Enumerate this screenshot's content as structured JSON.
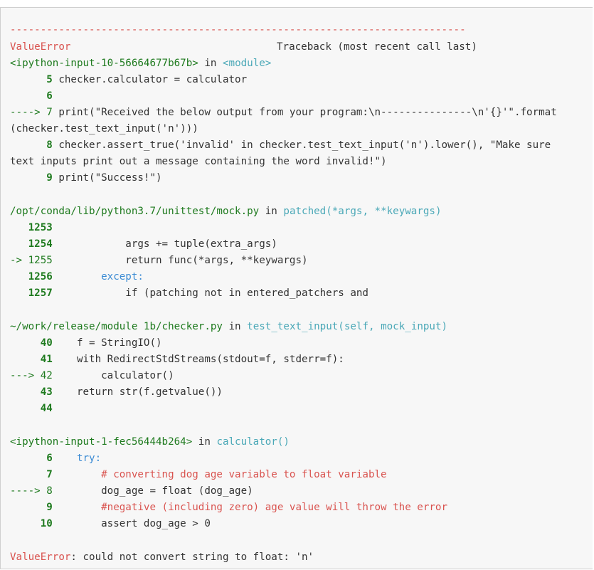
{
  "traceback": {
    "separator": "---------------------------------------------------------------------------",
    "error_type": "ValueError",
    "header_right": "Traceback (most recent call last)",
    "frame1": {
      "file": "<ipython-input-10-56664677b67b>",
      "in": "in",
      "func": "<module>",
      "l5_num": "5",
      "l5_code": "checker.calculator = calculator",
      "l6_num": "6",
      "l7_arrow": "----> 7",
      "l7_code": "print(\"Received the below output from your program:\\n---------------\\n'{}'\".format",
      "l7_cont": "(checker.test_text_input('n')))",
      "l8_num": "8",
      "l8_code": "checker.assert_true('invalid' in checker.test_text_input('n').lower(), \"Make sure",
      "l8_cont": "text inputs print out a message containing the word invalid!\")",
      "l9_num": "9",
      "l9_code": "print(\"Success!\")"
    },
    "frame2": {
      "file": "/opt/conda/lib/python3.7/unittest/mock.py",
      "in": "in",
      "func": "patched(*args, **keywargs)",
      "l1253": "1253",
      "l1254": "1254",
      "l1254_code": "            args += tuple(extra_args)",
      "l1255_arrow": "-> 1255",
      "l1255_code": "            return func(*args, **keywargs)",
      "l1256": "1256",
      "l1256_code": "        except:",
      "l1257": "1257",
      "l1257_code": "            if (patching not in entered_patchers and"
    },
    "frame3": {
      "file": "~/work/release/module 1b/checker.py",
      "in": "in",
      "func": "test_text_input(self, mock_input)",
      "l40": "40",
      "l40_code": "    f = StringIO()",
      "l41": "41",
      "l41_code": "    with RedirectStdStreams(stdout=f, stderr=f):",
      "l42_arrow": "---> 42",
      "l42_code": "        calculator()",
      "l43": "43",
      "l43_code": "    return str(f.getvalue())",
      "l44": "44"
    },
    "frame4": {
      "file": "<ipython-input-1-fec56444b264>",
      "in": "in",
      "func": "calculator()",
      "l6": "6",
      "l6_code": "    try:",
      "l7": "7",
      "l7_code": "        # converting dog age variable to float variable",
      "l8_arrow": "----> 8",
      "l8_code": "        dog_age = float (dog_age)",
      "l9": "9",
      "l9_code": "        #negative (including zero) age value will throw the error",
      "l10": "10",
      "l10_code": "        assert dog_age > 0"
    },
    "final_error_type": "ValueError",
    "final_message": ": could not convert string to float: 'n'"
  }
}
